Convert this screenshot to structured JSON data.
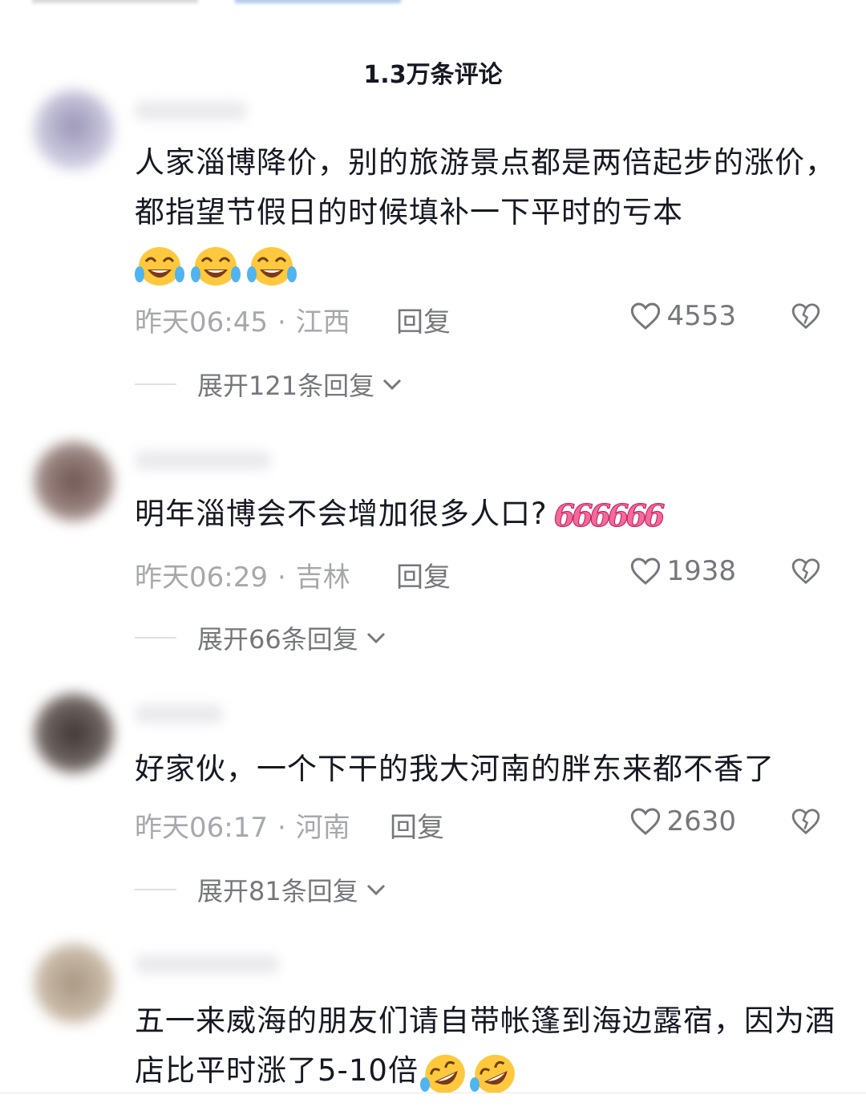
{
  "header": {
    "title": "1.3万条评论"
  },
  "icons": {
    "like": "heart-outline-icon",
    "dislike": "broken-heart-icon",
    "expand": "chevron-down-icon",
    "emoji_laugh": "laughing-tears-emoji",
    "emoji_rofl": "rolling-laughing-emoji",
    "sticker": "666-sticker"
  },
  "colors": {
    "text": "#161823",
    "meta": "#a7a8ad",
    "secondary": "#76777c",
    "sticker": "#f26a9a"
  },
  "comments": [
    {
      "text": "人家淄博降价，别的旅游景点都是两倍起步的涨价，都指望节假日的时候填补一下平时的亏本",
      "time": "昨天06:45",
      "location": "江西",
      "reply": "回复",
      "likes": "4553",
      "expand": "展开121条回复"
    },
    {
      "text": "明年淄博会不会增加很多人口?",
      "sticker": "666666",
      "time": "昨天06:29",
      "location": "吉林",
      "reply": "回复",
      "likes": "1938",
      "expand": "展开66条回复"
    },
    {
      "text": "好家伙，一个下干的我大河南的胖东来都不香了",
      "time": "昨天06:17",
      "location": "河南",
      "reply": "回复",
      "likes": "2630",
      "expand": "展开81条回复"
    },
    {
      "text": "五一来威海的朋友们请自带帐篷到海边露宿，因为酒店比平时涨了5-10倍"
    }
  ]
}
